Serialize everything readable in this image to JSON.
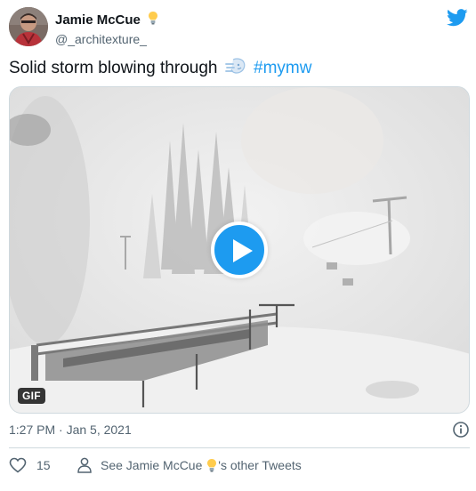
{
  "author": {
    "display_name": "Jamie McCue",
    "handle": "@_architexture_",
    "avatar_icon": "avatar-photo",
    "badge_icon": "lightbulb-icon"
  },
  "tweet": {
    "text_before": "Solid storm blowing through",
    "emoji_icon": "wind-face-icon",
    "hashtag": "#mymw"
  },
  "media": {
    "badge": "GIF",
    "play_icon": "play-icon",
    "scene": "snowstorm-chairlift"
  },
  "meta": {
    "timestamp": "1:27 PM · Jan 5, 2021",
    "info_icon": "info-icon"
  },
  "actions": {
    "like_count": "15",
    "see_prefix": "See Jamie McCue",
    "see_suffix": "'s other Tweets"
  },
  "colors": {
    "accent": "#1d9bf0",
    "text_primary": "#0f1419",
    "text_secondary": "#536471",
    "border": "#cfd9de"
  }
}
